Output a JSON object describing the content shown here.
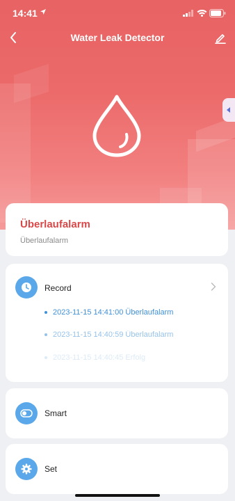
{
  "status_bar": {
    "time": "14:41"
  },
  "header": {
    "title": "Water Leak Detector"
  },
  "device_status": {
    "title": "Überlaufalarm",
    "subtitle": "Überlaufalarm"
  },
  "record": {
    "label": "Record",
    "items": [
      "2023-11-15 14:41:00 Überlaufalarm",
      "2023-11-15 14:40:59 Überlaufalarm",
      "2023-11-15 14:40:45 Erfolg"
    ]
  },
  "smart": {
    "label": "Smart"
  },
  "set": {
    "label": "Set"
  },
  "colors": {
    "hero": "#ec6a6a",
    "alarm_text": "#d94848",
    "accent_blue": "#5aa8ea",
    "record_text": "#3f90d8"
  },
  "icons": [
    "location-arrow-icon",
    "signal-icon",
    "wifi-icon",
    "battery-icon",
    "back-icon",
    "edit-icon",
    "water-drop-icon",
    "clock-icon",
    "toggle-icon",
    "gear-icon",
    "chevron-right-icon"
  ]
}
